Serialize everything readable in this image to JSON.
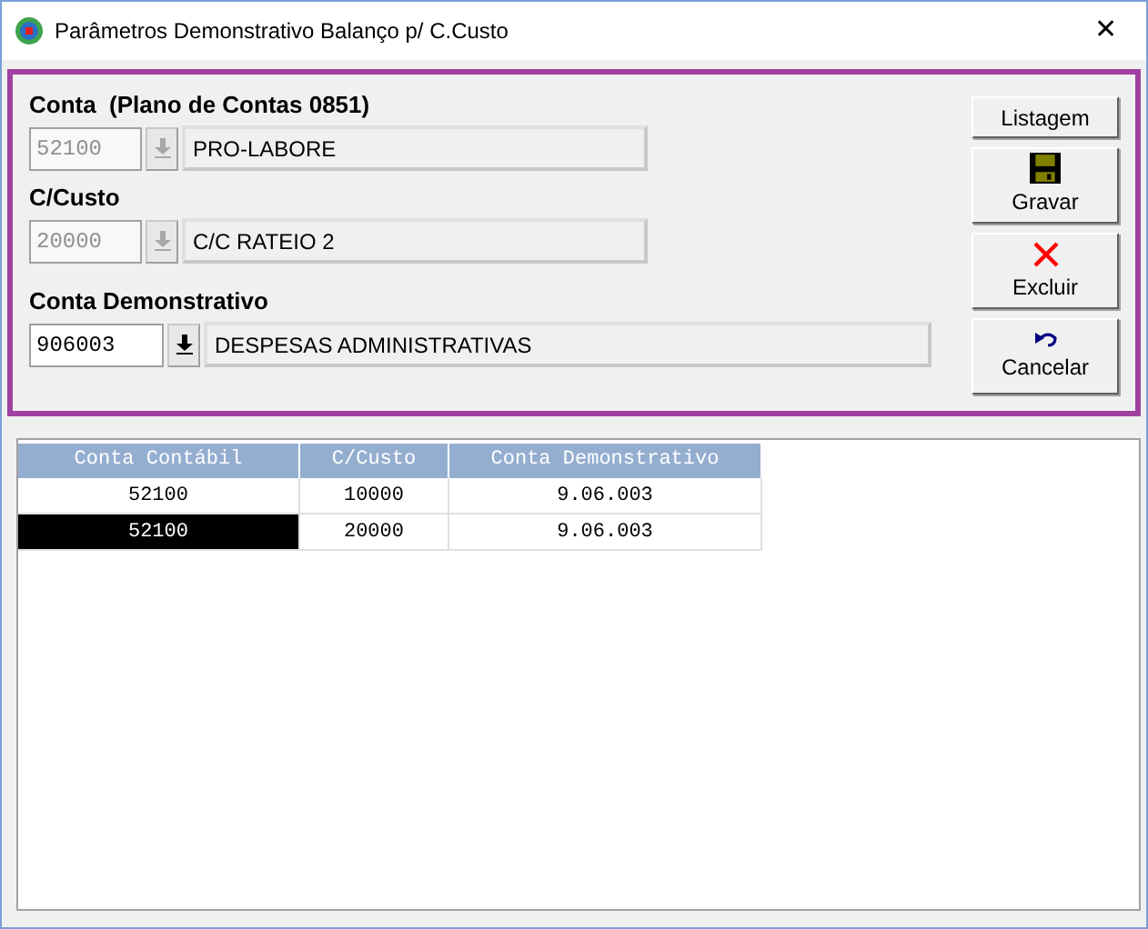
{
  "window": {
    "title": "Parâmetros Demonstrativo Balanço p/ C.Custo",
    "close": "✕"
  },
  "fields": [
    {
      "label": "Conta  (Plano de Contas 0851)",
      "code": "52100",
      "description": "PRO-LABORE",
      "disabled": true,
      "wide": false
    },
    {
      "label": "C/Custo",
      "code": "20000",
      "description": "C/C RATEIO 2",
      "disabled": true,
      "wide": false
    },
    {
      "label": "Conta Demonstrativo",
      "code": "906003",
      "description": "DESPESAS ADMINISTRATIVAS",
      "disabled": false,
      "wide": true
    }
  ],
  "buttons": [
    {
      "label": "Listagem",
      "kind": "text"
    },
    {
      "label": "Gravar",
      "kind": "save"
    },
    {
      "label": "Excluir",
      "kind": "delete"
    },
    {
      "label": "Cancelar",
      "kind": "undo"
    }
  ],
  "table": {
    "columns": [
      "Conta Contábil",
      "C/Custo",
      "Conta Demonstrativo"
    ],
    "rows": [
      {
        "cells": [
          "52100",
          "10000",
          "9.06.003"
        ],
        "selected": false
      },
      {
        "cells": [
          "52100",
          "20000",
          "9.06.003"
        ],
        "selected": true
      }
    ]
  }
}
